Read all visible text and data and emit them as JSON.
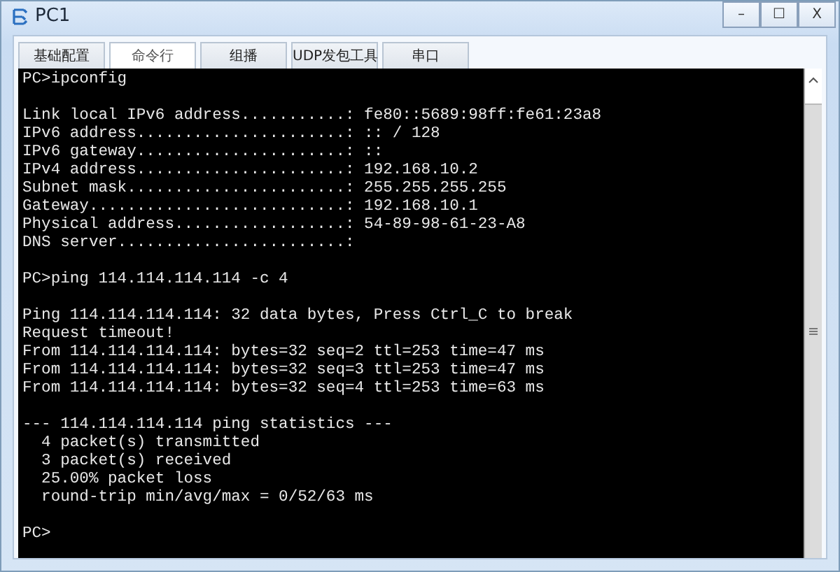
{
  "window": {
    "title": "PC1",
    "buttons": [
      "–",
      "☐",
      "X"
    ]
  },
  "tabs": [
    {
      "label": "基础配置",
      "selected": false
    },
    {
      "label": "命令行",
      "selected": true
    },
    {
      "label": "组播",
      "selected": false
    },
    {
      "label": "UDP发包工具",
      "selected": false
    },
    {
      "label": "串口",
      "selected": false
    }
  ],
  "terminal": {
    "blocks": [
      [
        "PC>ipconfig"
      ],
      [
        "Link local IPv6 address...........: fe80::5689:98ff:fe61:23a8",
        "IPv6 address......................: :: / 128",
        "IPv6 gateway......................: ::",
        "IPv4 address......................: 192.168.10.2",
        "Subnet mask.......................: 255.255.255.255",
        "Gateway...........................: 192.168.10.1",
        "Physical address..................: 54-89-98-61-23-A8",
        "DNS server........................:"
      ],
      [
        "PC>ping 114.114.114.114 -c 4"
      ],
      [
        "Ping 114.114.114.114: 32 data bytes, Press Ctrl_C to break",
        "Request timeout!",
        "From 114.114.114.114: bytes=32 seq=2 ttl=253 time=47 ms",
        "From 114.114.114.114: bytes=32 seq=3 ttl=253 time=47 ms",
        "From 114.114.114.114: bytes=32 seq=4 ttl=253 time=63 ms"
      ],
      [
        "--- 114.114.114.114 ping statistics ---",
        "  4 packet(s) transmitted",
        "  3 packet(s) received",
        "  25.00% packet loss",
        "  round-trip min/avg/max = 0/52/63 ms"
      ],
      [
        "PC>"
      ]
    ]
  }
}
